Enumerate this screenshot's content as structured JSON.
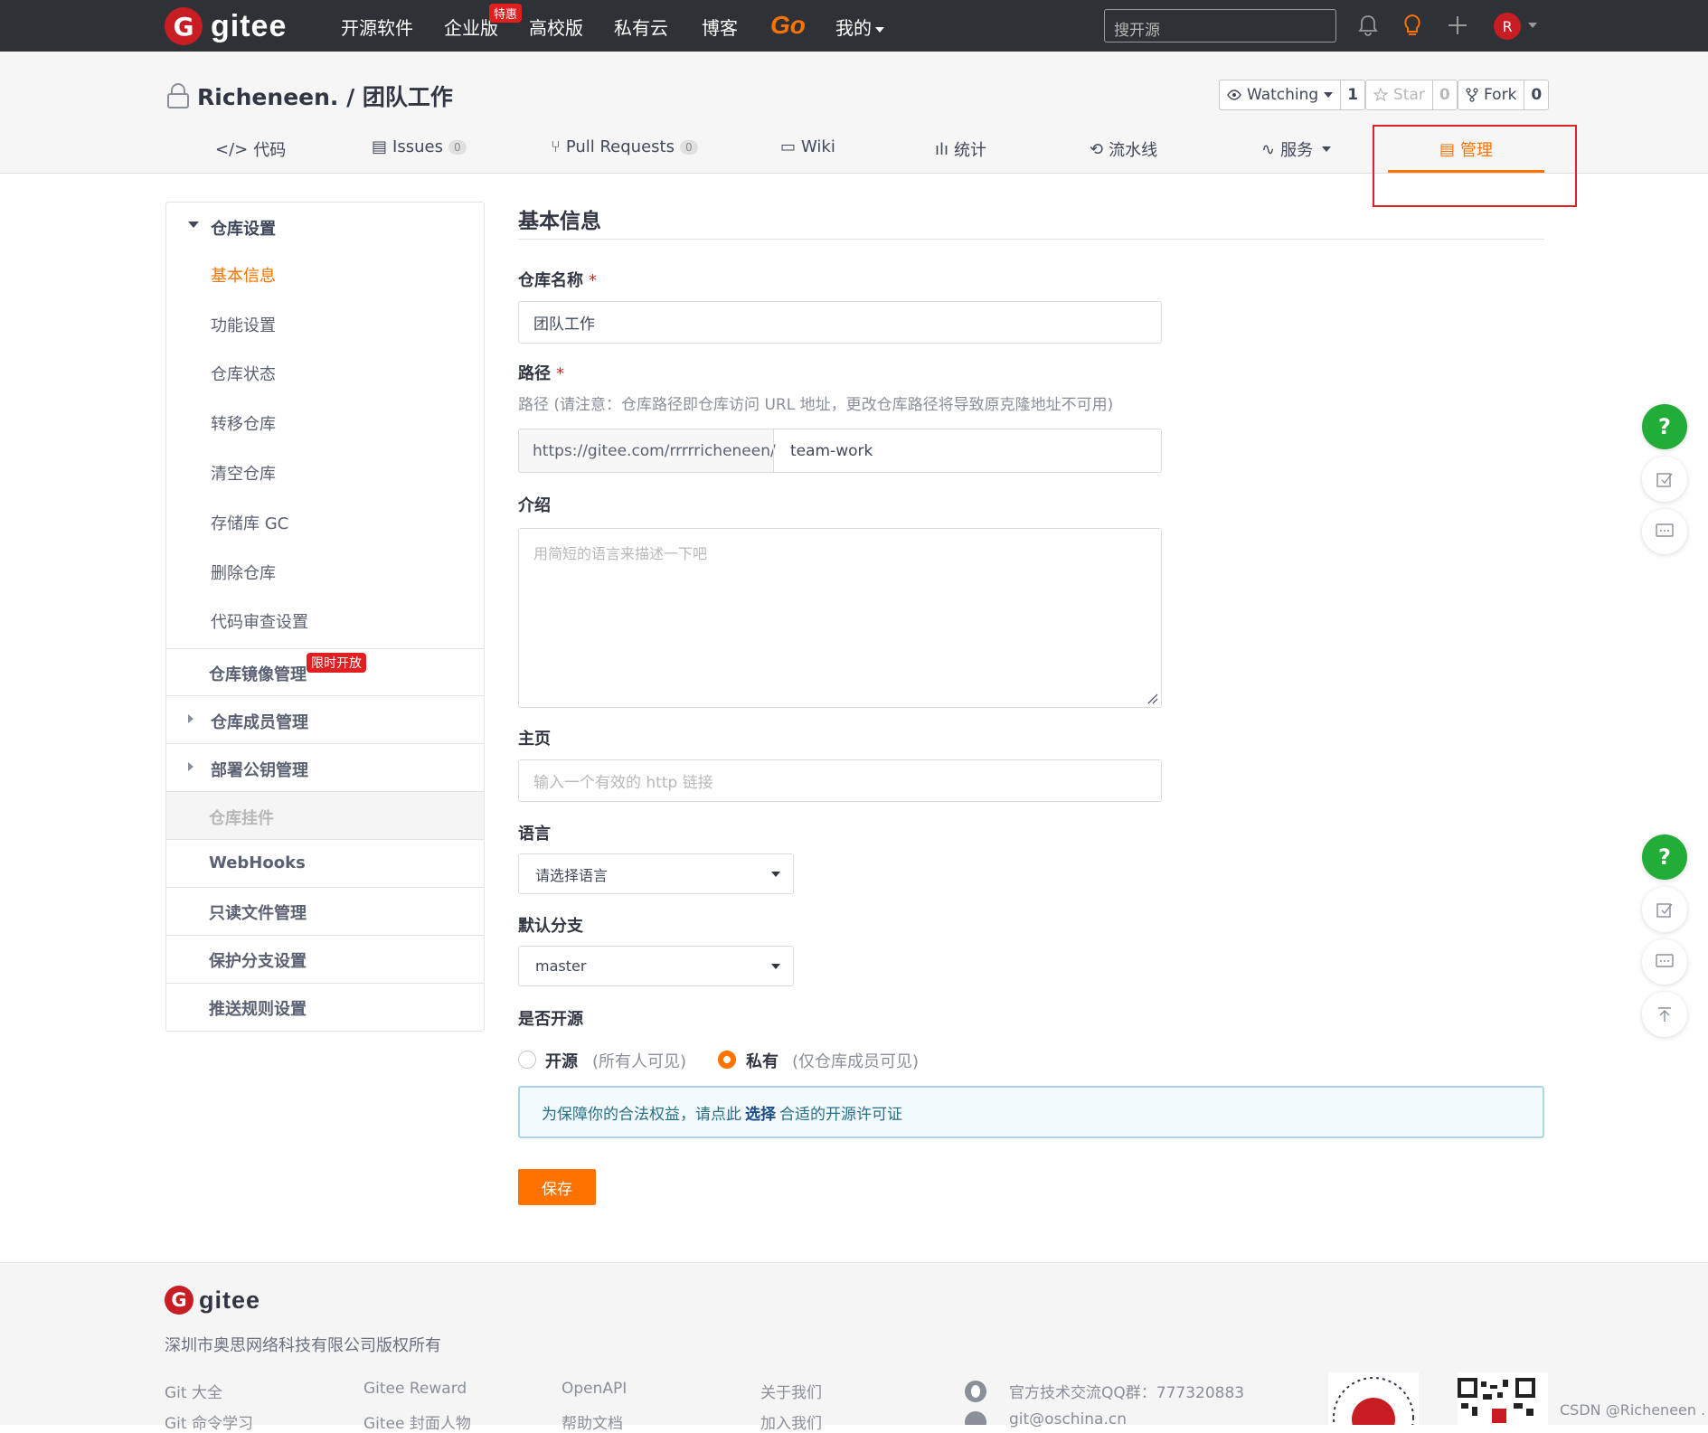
{
  "topnav": {
    "logo_letter": "G",
    "logo_text": "gitee",
    "items": [
      "开源软件",
      "企业版",
      "高校版",
      "私有云",
      "博客"
    ],
    "enterprise_badge": "特惠",
    "go_label": "Go",
    "mine_label": "我的",
    "search_placeholder": "搜开源",
    "avatar_letter": "R"
  },
  "repo": {
    "title": "Richeneen. / 团队工作",
    "watching_label": "Watching",
    "watching_count": "1",
    "star_label": "Star",
    "star_count": "0",
    "fork_label": "Fork",
    "fork_count": "0"
  },
  "tabs": {
    "code": "代码",
    "issues": "Issues",
    "issues_count": "0",
    "pulls": "Pull Requests",
    "pulls_count": "0",
    "wiki": "Wiki",
    "stats": "统计",
    "pipeline": "流水线",
    "service": "服务",
    "manage": "管理"
  },
  "sidebar": {
    "group_title": "仓库设置",
    "items": [
      "基本信息",
      "功能设置",
      "仓库状态",
      "转移仓库",
      "清空仓库",
      "存储库 GC",
      "删除仓库",
      "代码审查设置"
    ],
    "mirror": "仓库镜像管理",
    "mirror_badge": "限时开放",
    "members": "仓库成员管理",
    "deploy_keys": "部署公钥管理",
    "widgets": "仓库挂件",
    "webhooks": "WebHooks",
    "readonly": "只读文件管理",
    "protect": "保护分支设置",
    "push_rules": "推送规则设置"
  },
  "form": {
    "section_title": "基本信息",
    "name_label": "仓库名称",
    "required_mark": "*",
    "name_value": "团队工作",
    "path_label": "路径",
    "path_hint": "路径 (请注意：仓库路径即仓库访问 URL 地址，更改仓库路径将导致原克隆地址不可用)",
    "path_prefix": "https://gitee.com/rrrrricheneen/",
    "path_value": "team-work",
    "intro_label": "介绍",
    "intro_placeholder": "用简短的语言来描述一下吧",
    "homepage_label": "主页",
    "homepage_placeholder": "输入一个有效的 http 链接",
    "language_label": "语言",
    "language_value": "请选择语言",
    "branch_label": "默认分支",
    "branch_value": "master",
    "open_label": "是否开源",
    "open_option": "开源",
    "open_sub": "(所有人可见)",
    "private_option": "私有",
    "private_sub": "(仅仓库成员可见)",
    "selected_visibility": "私有",
    "notice_before": "为保障你的合法权益，请点此",
    "notice_link": "选择",
    "notice_after": "合适的开源许可证",
    "save_label": "保存"
  },
  "floating": {
    "help": "?"
  },
  "footer": {
    "logo_text": "gitee",
    "copyright": "深圳市奥思网络科技有限公司版权所有",
    "col1": [
      "Git 大全",
      "Git 命令学习"
    ],
    "col2": [
      "Gitee Reward",
      "Gitee 封面人物"
    ],
    "col3": [
      "OpenAPI",
      "帮助文档"
    ],
    "col4": [
      "关于我们",
      "加入我们"
    ],
    "qq": "官方技术交流QQ群：777320883",
    "email": "git@oschina.cn",
    "watermark": "CSDN @Richeneen ."
  },
  "colors": {
    "brand_orange": "#fe7300",
    "brand_red": "#c71d23",
    "nav_bg": "#2e3136",
    "success_green": "#22ac38"
  },
  "icons": [
    "lock-icon",
    "eye-icon",
    "star-icon",
    "fork-icon",
    "code-icon",
    "issues-icon",
    "pull-request-icon",
    "wiki-icon",
    "stats-icon",
    "pipeline-icon",
    "service-icon",
    "manage-icon",
    "bell-icon",
    "bulb-icon",
    "plus-icon",
    "help-icon",
    "edit-icon",
    "comment-icon",
    "back-to-top-icon"
  ]
}
